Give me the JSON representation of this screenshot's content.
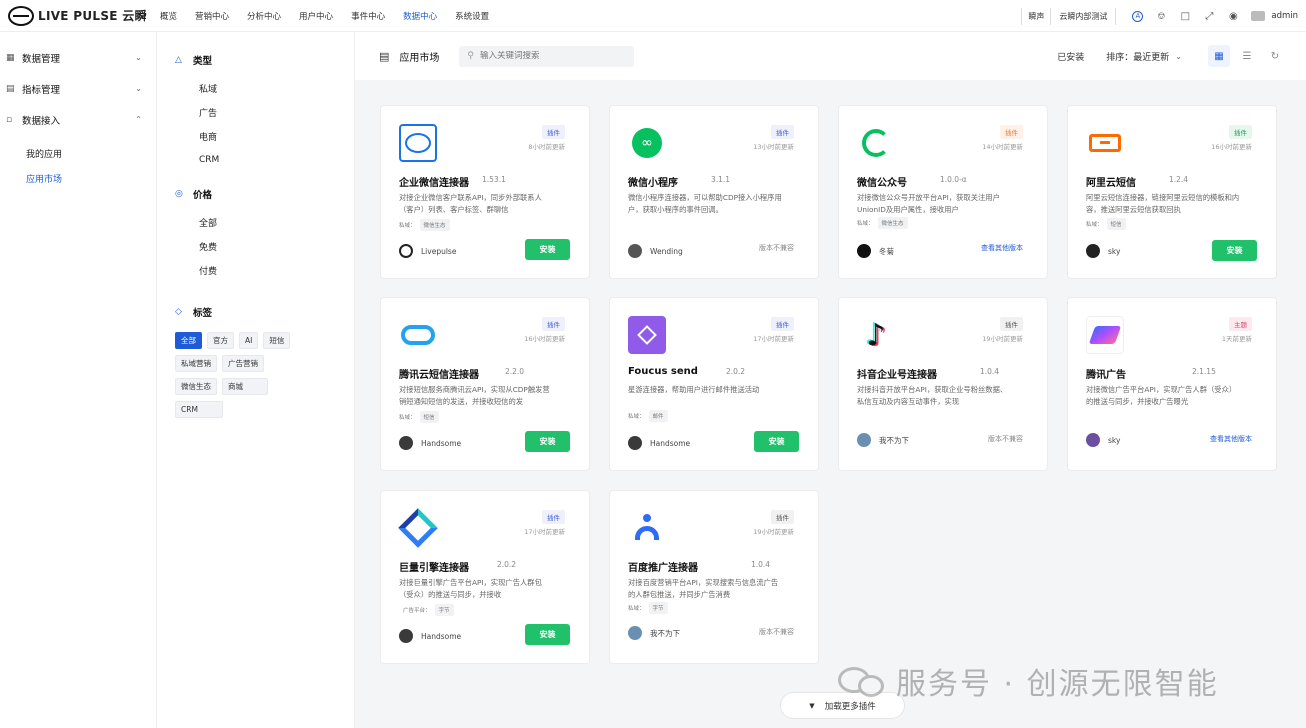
{
  "brand": {
    "name": "LIVE PULSE 云瞬"
  },
  "nav": [
    "概览",
    "营销中心",
    "分析中心",
    "用户中心",
    "事件中心",
    "数据中心",
    "系统设置"
  ],
  "nav_active": 5,
  "topbar": {
    "env": "瞬声",
    "workspace": "云瞬内部测试",
    "user": "admin"
  },
  "sidebar": {
    "groups": [
      {
        "label": "数据管理",
        "icon": "grid-icon"
      },
      {
        "label": "指标管理",
        "icon": "chart-icon"
      },
      {
        "label": "数据接入",
        "icon": "plug-icon"
      }
    ],
    "subitems": [
      "我的应用",
      "应用市场"
    ]
  },
  "filters": {
    "type_title": "类型",
    "types": [
      "私域",
      "广告",
      "电商",
      "CRM"
    ],
    "price_title": "价格",
    "prices": [
      "全部",
      "免费",
      "付费"
    ],
    "tag_title": "标签",
    "tags": [
      "全部",
      "官方",
      "AI",
      "短信",
      "私域营销",
      "广告营销",
      "微信生态",
      "商城",
      "CRM"
    ]
  },
  "main": {
    "title": "应用市场",
    "search_placeholder": "输入关键词搜索",
    "installed": "已安装",
    "sort": "排序：最近更新",
    "load_more": "加载更多插件"
  },
  "cards": [
    {
      "name": "企业微信连接器",
      "version": "1.53.1",
      "badge": "插件",
      "time": "8小时前更新",
      "desc": "对接企业微信客户联系API，同步外部联系人（客户）列表、客户标签、群聊信",
      "meta_label": "私域：",
      "meta_value": "微信生态",
      "author": "Livepulse",
      "action": "安装"
    },
    {
      "name": "微信小程序",
      "version": "3.1.1",
      "badge": "插件",
      "time": "13小时前更新",
      "desc": "微信小程序连接器，可以帮助CDP接入小程序用户，获取小程序的事件回调。",
      "meta_label": "",
      "meta_value": "",
      "author": "Wending",
      "action": "版本不兼容"
    },
    {
      "name": "微信公众号",
      "version": "1.0.0-α",
      "badge": "插件",
      "time": "14小时前更新",
      "desc": "对接微信公众号开放平台API，获取关注用户UnionID及用户属性，接收用户",
      "meta_label": "私域：",
      "meta_value": "微信生态",
      "author": "冬菊",
      "action": "查看其他版本"
    },
    {
      "name": "阿里云短信",
      "version": "1.2.4",
      "badge": "插件",
      "time": "16小时前更新",
      "desc": "阿里云短信连接器，链接阿里云短信的模板和内容，推送阿里云短信获取回执",
      "meta_label": "私域：",
      "meta_value": "短信",
      "author": "sky",
      "action": "安装"
    },
    {
      "name": "腾讯云短信连接器",
      "version": "2.2.0",
      "badge": "插件",
      "time": "16小时前更新",
      "desc": "对接短信服务商腾讯云API，实现从CDP触发营销短通知短信的发送，并接收短信的发",
      "meta_label": "私域：",
      "meta_value": "短信",
      "author": "Handsome",
      "action": "安装"
    },
    {
      "name": "Foucus send",
      "version": "2.0.2",
      "badge": "插件",
      "time": "17小时前更新",
      "desc": "星游连接器，帮助用户进行邮件推送活动",
      "meta_label": "私域：",
      "meta_value": "邮件",
      "author": "Handsome",
      "action": "安装"
    },
    {
      "name": "抖音企业号连接器",
      "version": "1.0.4",
      "badge": "插件",
      "time": "19小时前更新",
      "desc": "对接抖音开放平台API，获取企业号粉丝数据、私信互动及内容互动事件，实现",
      "meta_label": "",
      "meta_value": "",
      "author": "我不为下",
      "action": "版本不兼容"
    },
    {
      "name": "腾讯广告",
      "version": "2.1.15",
      "badge": "主题",
      "time": "1天前更新",
      "desc": "对接微信广告平台API，实现广告人群（受众）的推送与同步，并接收广告曝光",
      "meta_label": "",
      "meta_value": "",
      "author": "sky",
      "action": "查看其他版本"
    },
    {
      "name": "巨量引擎连接器",
      "version": "2.0.2",
      "badge": "插件",
      "time": "17小时前更新",
      "desc": "对接巨量引擎广告平台API，实现广告人群包（受众）的推送与同步，并接收",
      "meta_label": "广告平台：",
      "meta_value": "字节",
      "author": "Handsome",
      "action": "安装"
    },
    {
      "name": "百度推广连接器",
      "version": "1.0.4",
      "badge": "插件",
      "time": "19小时前更新",
      "desc": "对接百度营销平台API，实现搜索与信息流广告的人群包推送，并同步广告消费",
      "meta_label": "私域：",
      "meta_value": "字节",
      "author": "我不为下",
      "action": "版本不兼容"
    }
  ],
  "watermark": "服务号 · 创源无限智能"
}
